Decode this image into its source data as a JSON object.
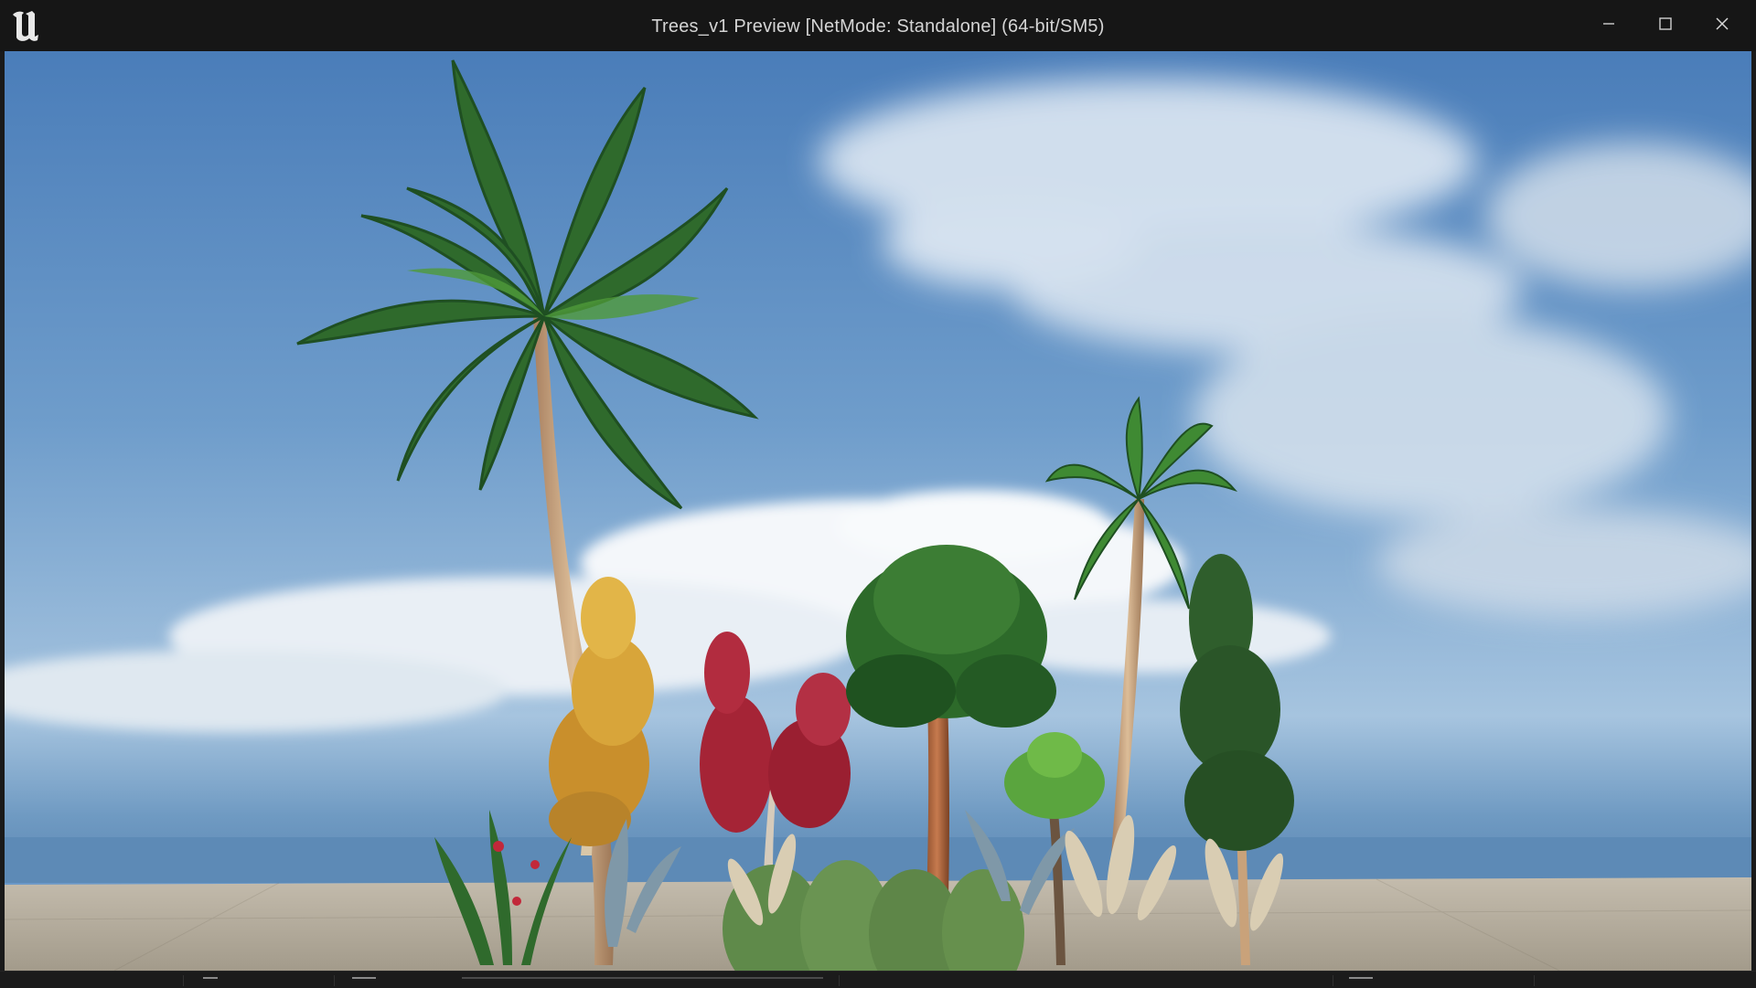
{
  "window": {
    "title": "Trees_v1 Preview [NetMode: Standalone]  (64-bit/SM5)",
    "app_icon": "unreal-engine-logo",
    "controls": {
      "minimize_icon": "minimize-icon",
      "maximize_icon": "maximize-icon",
      "close_icon": "close-icon"
    }
  },
  "viewport": {
    "scene": "game-preview-viewport",
    "colors": {
      "sky_top": "#4f7fb8",
      "sky_horizon": "#b9d0e2",
      "ground": "#b2aa9a",
      "palm_leaf": "#2f6a2c",
      "palm_trunk": "#c9a27a",
      "yellow_tree": "#d8a53a",
      "red_tree": "#a52436"
    }
  },
  "colors": {
    "titlebar_bg": "#161616",
    "title_text": "#d4d4d4",
    "frame": "#1a1a1a"
  }
}
